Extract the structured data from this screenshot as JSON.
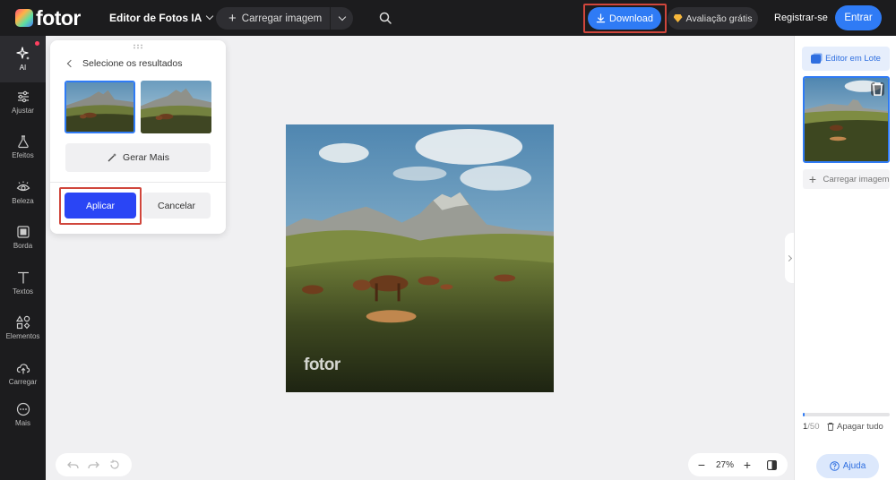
{
  "app": {
    "logo_text": "fotor",
    "editor_title": "Editor de Fotos IA"
  },
  "header": {
    "upload_label": "Carregar imagem",
    "download_label": "Download",
    "trial_label": "Avaliação grátis",
    "register_label": "Registrar-se",
    "login_label": "Entrar"
  },
  "sidebar": {
    "items": [
      {
        "label": "AI",
        "icon": "sparkle-icon"
      },
      {
        "label": "Ajustar",
        "icon": "sliders-icon"
      },
      {
        "label": "Efeitos",
        "icon": "flask-icon"
      },
      {
        "label": "Beleza",
        "icon": "eye-icon"
      },
      {
        "label": "Borda",
        "icon": "frame-icon"
      },
      {
        "label": "Textos",
        "icon": "text-icon"
      },
      {
        "label": "Elementos",
        "icon": "shapes-icon"
      },
      {
        "label": "Carregar",
        "icon": "cloud-upload-icon"
      },
      {
        "label": "Mais",
        "icon": "more-icon"
      }
    ]
  },
  "ai_panel": {
    "title": "Selecione os resultados",
    "generate_more_label": "Gerar Mais",
    "apply_label": "Aplicar",
    "cancel_label": "Cancelar"
  },
  "canvas": {
    "watermark": "fotor"
  },
  "zoom": {
    "minus": "−",
    "value": "27%",
    "plus": "+"
  },
  "right_panel": {
    "batch_label": "Editor em Lote",
    "add_image_label": "Carregar imagem",
    "count_current": "1",
    "count_total": "/50",
    "progress": 0.02,
    "clear_label": "Apagar tudo",
    "help_label": "Ajuda"
  },
  "colors": {
    "accent": "#2f7bf5",
    "apply": "#2a45f5",
    "highlight": "#d0463c",
    "topbar": "#1c1c1e"
  }
}
